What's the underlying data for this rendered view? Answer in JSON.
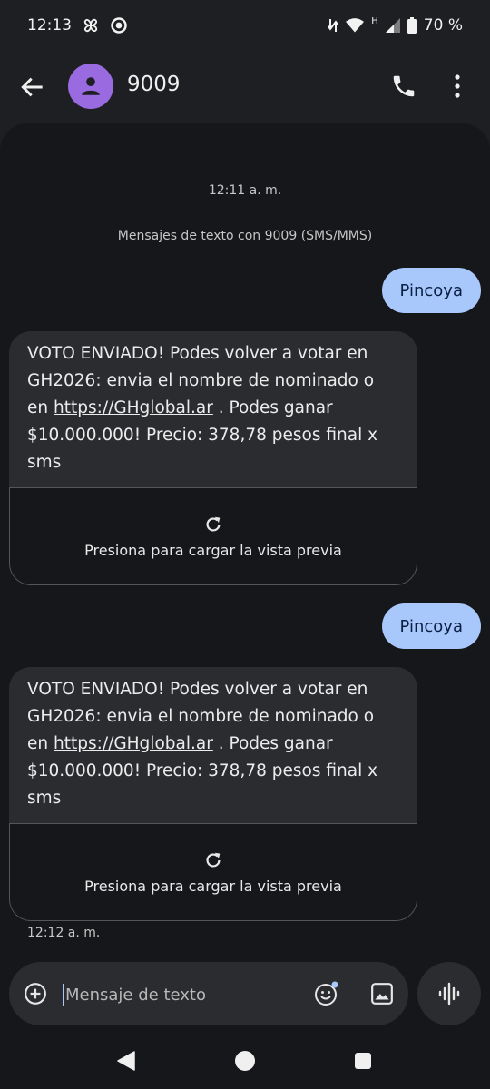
{
  "status_bar": {
    "time": "12:13",
    "network_type": "H",
    "battery": "70 %"
  },
  "header": {
    "contact_name": "9009"
  },
  "conversation": {
    "first_timestamp": "12:11 a. m.",
    "info_text": "Mensajes de texto con 9009 (SMS/MMS)",
    "messages": [
      {
        "type": "sent",
        "text": "Pincoya"
      },
      {
        "type": "received",
        "text_before_link": "VOTO ENVIADO! Podes volver a votar en GH2026: envia el nombre de nominado o en ",
        "link": "https://GHglobal.ar",
        "text_after_link": " . Podes ganar $10.000.000! Precio: 378,78 pesos final x sms",
        "preview_label": "Presiona para cargar la vista previa"
      },
      {
        "type": "sent",
        "text": "Pincoya"
      },
      {
        "type": "received",
        "text_before_link": "VOTO ENVIADO! Podes volver a votar en GH2026: envia el nombre de nominado o en ",
        "link": "https://GHglobal.ar",
        "text_after_link": " . Podes ganar $10.000.000! Precio: 378,78 pesos final x sms",
        "preview_label": "Presiona para cargar la vista previa"
      }
    ],
    "last_timestamp": "12:12 a. m."
  },
  "composer": {
    "placeholder": "Mensaje de texto"
  },
  "icons": {
    "back": "arrow-back-icon",
    "avatar": "person-icon",
    "call": "phone-icon",
    "more": "more-vert-icon",
    "refresh": "refresh-icon",
    "add": "add-circle-icon",
    "emoji": "emoji-icon",
    "image": "image-icon",
    "voice": "voice-wave-icon"
  },
  "colors": {
    "sent_bubble": "#a8c7fa",
    "avatar": "#9a6ae0",
    "received_bubble": "#2b2c30",
    "background": "#16171a"
  }
}
